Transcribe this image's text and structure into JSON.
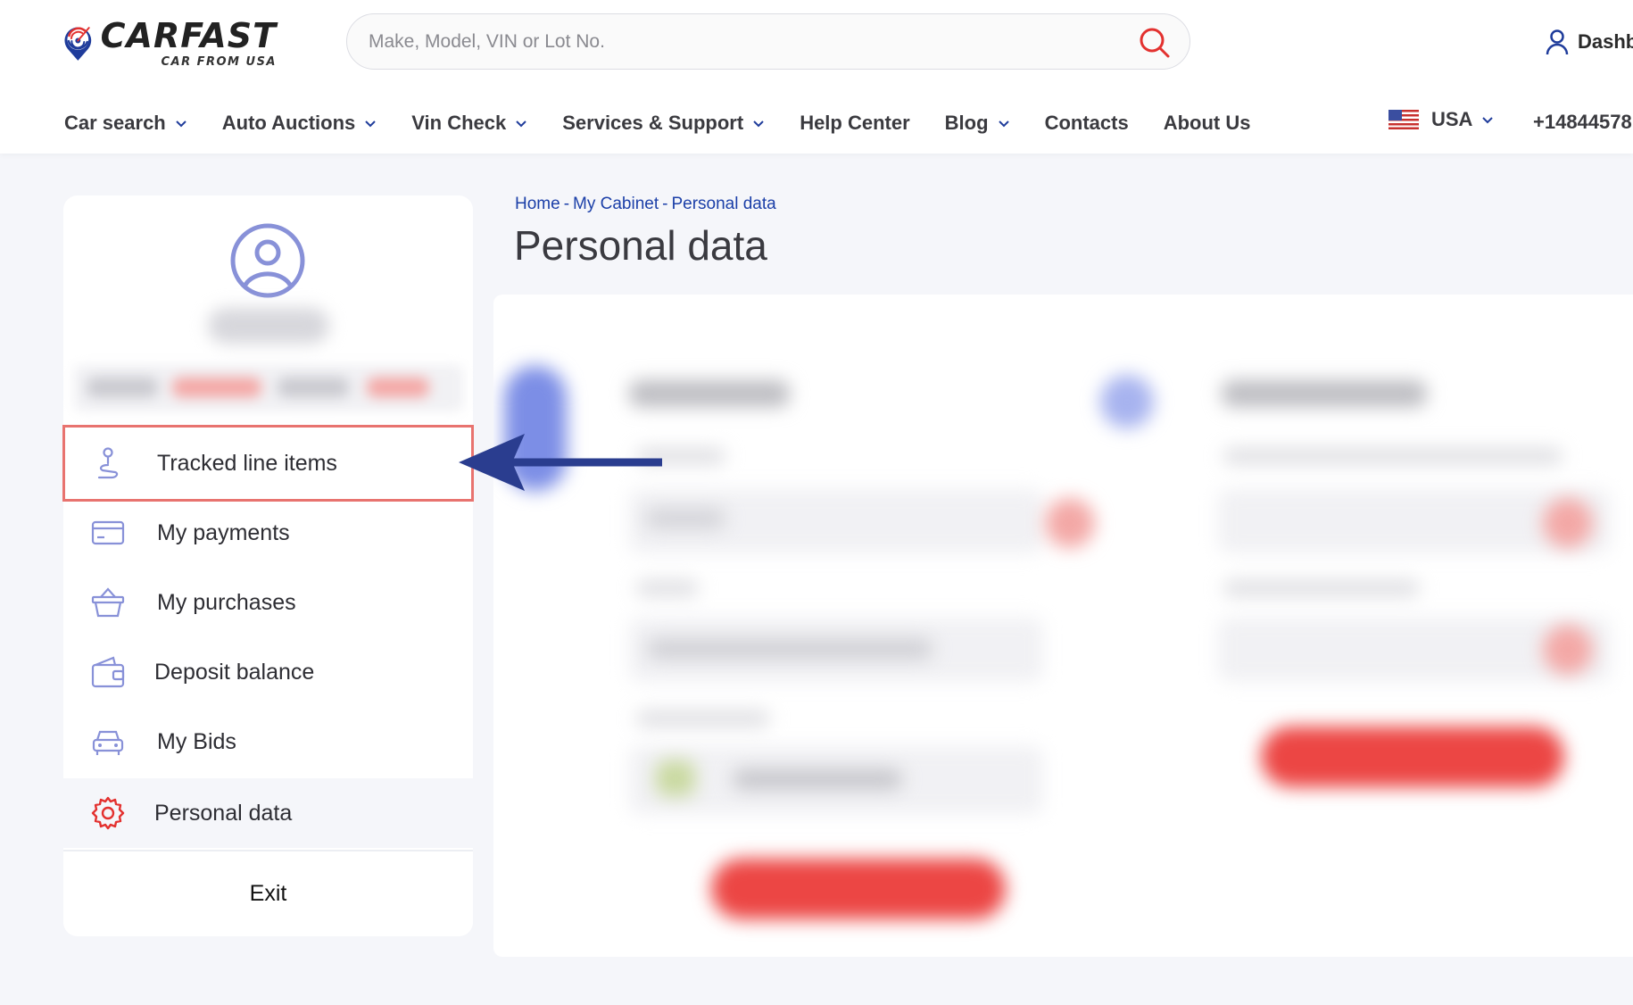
{
  "brand": {
    "title": "CARFAST",
    "subtitle": "CAR FROM USA",
    "colors": {
      "blue": "#1f3c9b",
      "red": "#e3312f"
    }
  },
  "search": {
    "placeholder": "Make, Model, VIN or Lot No.",
    "value": "",
    "icon": "search-icon"
  },
  "account": {
    "label": "Dashb",
    "icon": "user-icon"
  },
  "nav": {
    "items": [
      {
        "label": "Car search",
        "has_dropdown": true
      },
      {
        "label": "Auto Auctions",
        "has_dropdown": true
      },
      {
        "label": "Vin Check",
        "has_dropdown": true
      },
      {
        "label": "Services & Support",
        "has_dropdown": true
      },
      {
        "label": "Help Center",
        "has_dropdown": false
      },
      {
        "label": "Blog",
        "has_dropdown": true
      },
      {
        "label": "Contacts",
        "has_dropdown": false
      },
      {
        "label": "About Us",
        "has_dropdown": false
      }
    ],
    "country": "USA",
    "phone": "+14844578"
  },
  "sidebar": {
    "avatar_icon": "user-circle-icon",
    "items": [
      {
        "label": "Tracked line items",
        "icon": "route-pin-icon",
        "highlighted": true
      },
      {
        "label": "My payments",
        "icon": "credit-card-icon"
      },
      {
        "label": "My purchases",
        "icon": "basket-icon"
      },
      {
        "label": "Deposit balance",
        "icon": "wallet-icon"
      },
      {
        "label": "My Bids",
        "icon": "car-icon"
      },
      {
        "label": "Personal data",
        "icon": "gear-icon",
        "active": true
      }
    ],
    "exit_label": "Exit"
  },
  "breadcrumb": {
    "items": [
      "Home",
      "My Cabinet",
      "Personal data"
    ],
    "separator": "-"
  },
  "page": {
    "title": "Personal data"
  },
  "annotation": {
    "highlight_color": "#e8736f",
    "arrow_color": "#2a3d8f"
  }
}
